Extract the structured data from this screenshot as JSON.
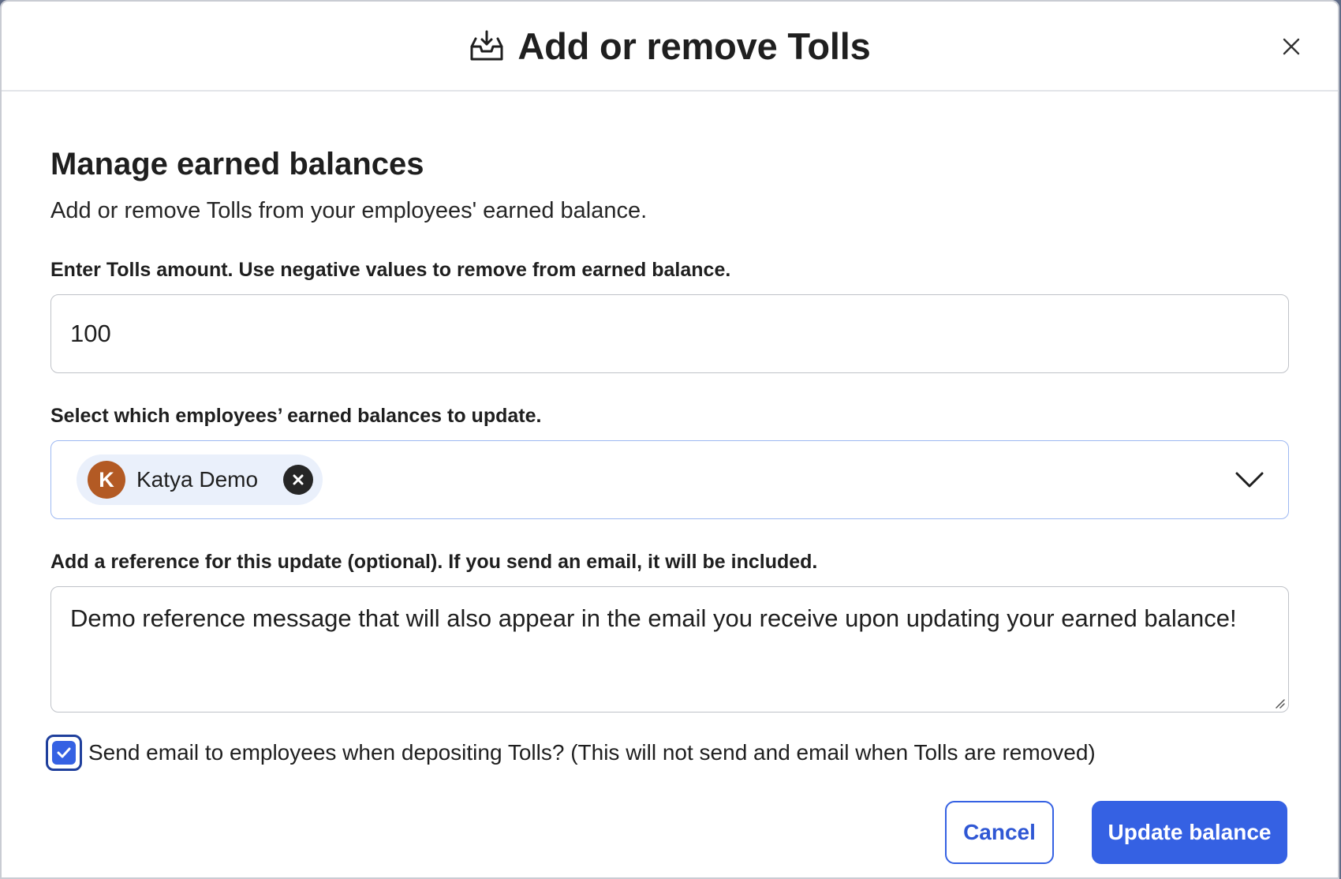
{
  "dialog": {
    "title": "Add or remove Tolls",
    "icon": "inbox-download-icon",
    "close_icon": "close-icon"
  },
  "section": {
    "title": "Manage earned balances",
    "description": "Add or remove Tolls from your employees' earned balance."
  },
  "amount": {
    "label": "Enter Tolls amount. Use negative values to remove from earned balance.",
    "value": "100"
  },
  "employees": {
    "label": "Select which employees’ earned balances to update.",
    "selected": [
      {
        "initial": "K",
        "name": "Katya Demo",
        "avatar_color": "#b35a24"
      }
    ],
    "dropdown_icon": "chevron-down-icon"
  },
  "reference": {
    "label": "Add a reference for this update (optional). If you send an email, it will be included.",
    "value": "Demo reference message that will also appear in the email you receive upon updating your earned balance!"
  },
  "send_email": {
    "checked": true,
    "label": "Send email to employees when depositing Tolls? (This will not send and email when Tolls are removed)"
  },
  "footer": {
    "cancel_label": "Cancel",
    "submit_label": "Update balance"
  },
  "colors": {
    "accent": "#3561e3",
    "accent_dark": "#1f3f9c",
    "chip_bg": "#eaf0fb"
  }
}
